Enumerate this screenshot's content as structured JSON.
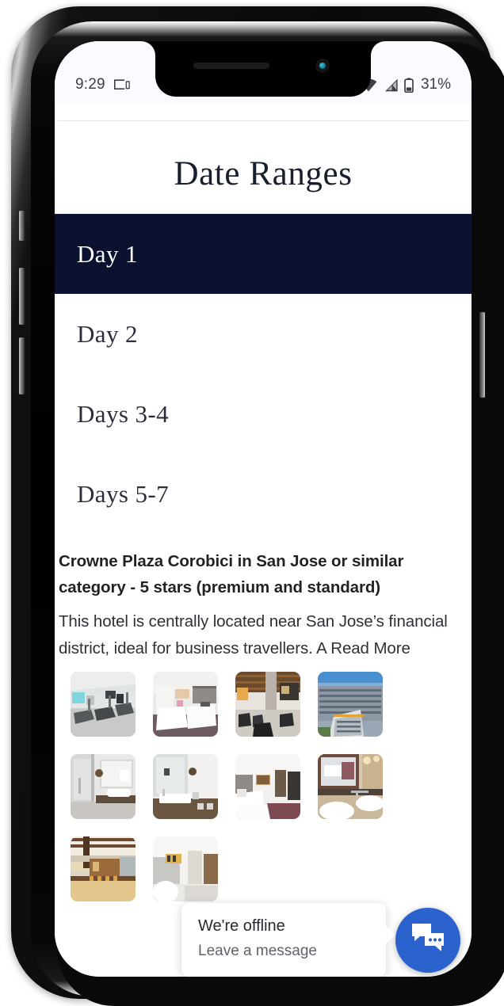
{
  "status_bar": {
    "time": "9:29",
    "cast_icon": "cast-screen-icon",
    "wifi_icon": "wifi-icon",
    "signal_icon": "cell-signal-icon",
    "battery_icon": "battery-icon",
    "battery_percent": "31%"
  },
  "page": {
    "title": "Date Ranges"
  },
  "date_ranges": {
    "items": [
      {
        "label": "Day 1",
        "active": true
      },
      {
        "label": "Day 2",
        "active": false
      },
      {
        "label": "Days 3-4",
        "active": false
      },
      {
        "label": "Days 5-7",
        "active": false
      }
    ],
    "active_bg": "#0c1130",
    "active_fg": "#ffffff"
  },
  "hotel": {
    "title": "Crowne Plaza Corobici in San Jose or similar category - 5 stars (premium and standard)",
    "description": "This hotel is centrally located near San Jose’s financial district, ideal for business travellers. A",
    "read_more_label": "Read More",
    "thumbnails": [
      {
        "name": "fitness-center-thumbnail"
      },
      {
        "name": "twin-bedroom-thumbnail"
      },
      {
        "name": "lobby-lounge-thumbnail"
      },
      {
        "name": "hotel-exterior-thumbnail"
      },
      {
        "name": "bathroom-shower-thumbnail"
      },
      {
        "name": "bathroom-vanity-thumbnail"
      },
      {
        "name": "guest-room-thumbnail"
      },
      {
        "name": "bathroom-basin-thumbnail"
      },
      {
        "name": "restaurant-bar-thumbnail"
      },
      {
        "name": "corridor-room-thumbnail"
      }
    ]
  },
  "chat_widget": {
    "title": "We're offline",
    "subtitle": "Leave a message",
    "button_icon": "chat-bubbles-icon",
    "accent_color": "#2b62cd"
  },
  "device": {
    "speaker": "earpiece-speaker",
    "camera": "front-camera",
    "buttons": [
      "mute-switch",
      "volume-up-button",
      "volume-down-button",
      "power-button"
    ]
  }
}
